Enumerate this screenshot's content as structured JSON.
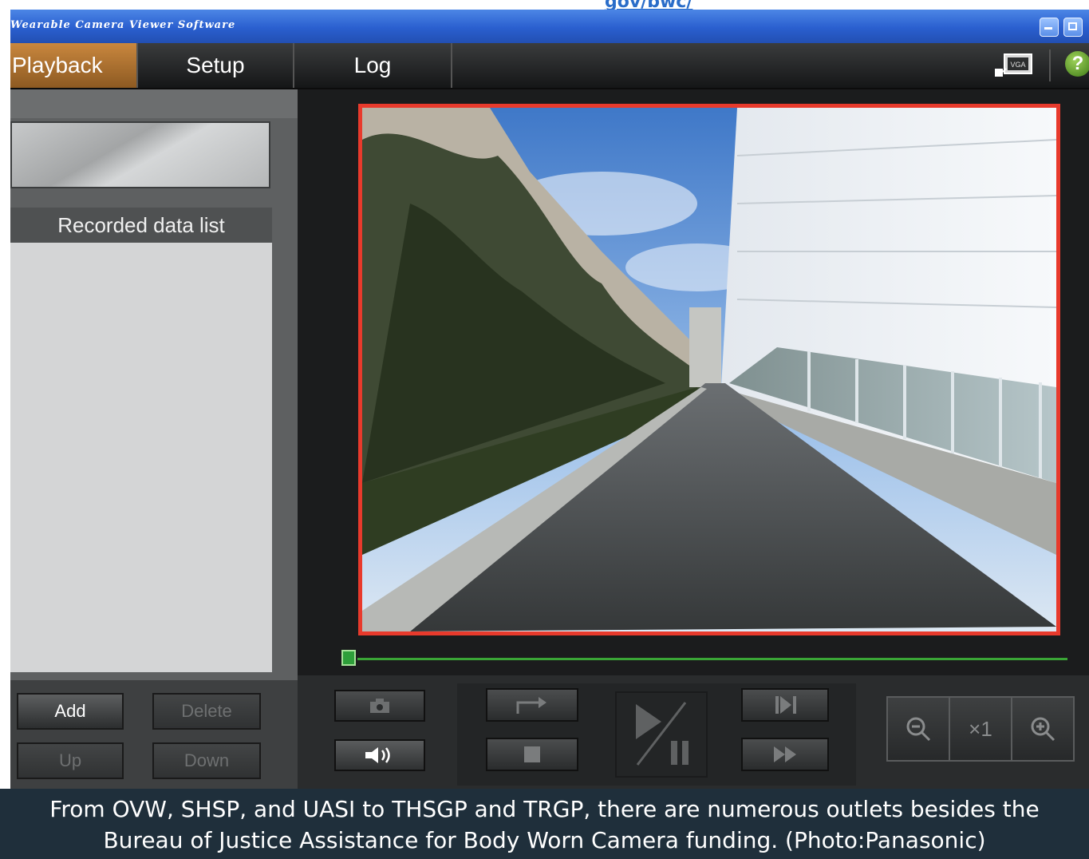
{
  "top_link": "gov/bwc/",
  "app": {
    "title": "Wearable Camera Viewer Software",
    "menu": {
      "tabs": [
        {
          "label": "Playback",
          "active": true
        },
        {
          "label": "Setup",
          "active": false
        },
        {
          "label": "Log",
          "active": false
        }
      ],
      "vga_label": "VGA",
      "help_label": "?"
    },
    "left_panel": {
      "list_header": "Recorded data list",
      "buttons": {
        "add": "Add",
        "delete": "Delete",
        "up": "Up",
        "down": "Down"
      }
    },
    "player": {
      "zoom_level": "×1",
      "highlight_color": "#e83a2c",
      "timeline_color": "#3aa536"
    }
  },
  "caption": {
    "line1": "From OVW, SHSP, and UASI to THSGP and TRGP, there are numerous outlets besides the",
    "line2": "Bureau of Justice Assistance for Body Worn Camera funding. (Photo:Panasonic)"
  }
}
